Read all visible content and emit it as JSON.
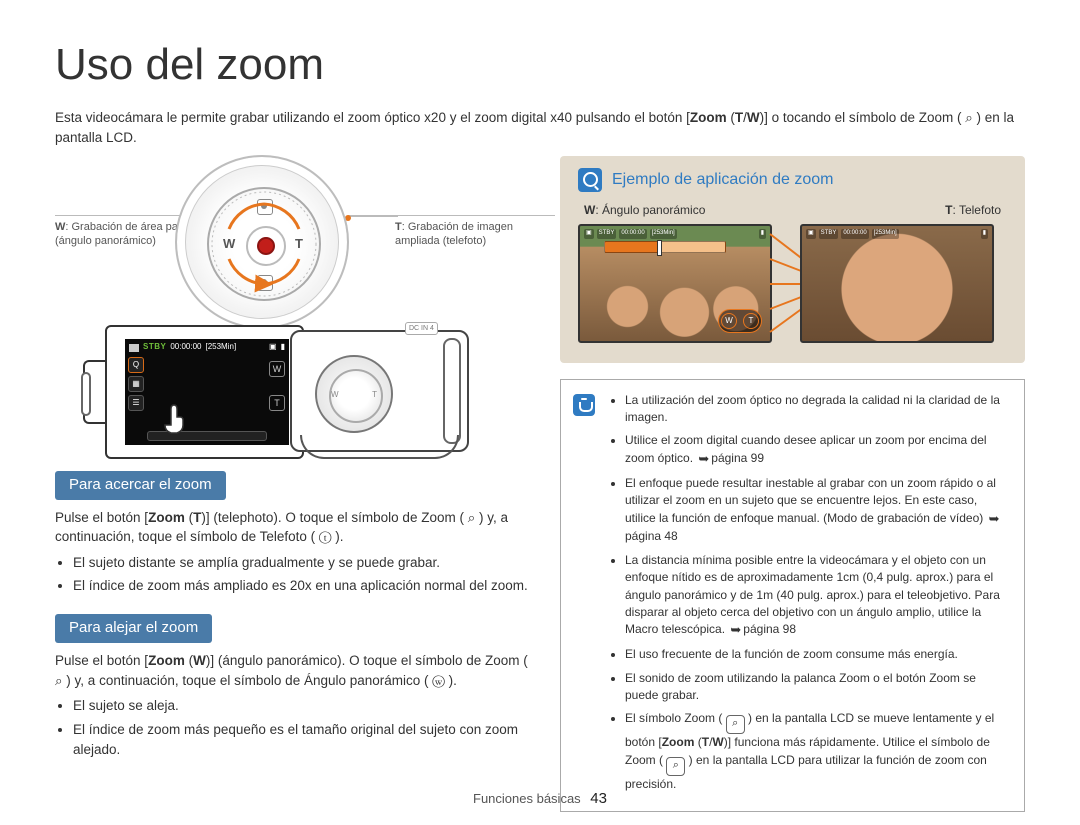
{
  "title": "Uso del zoom",
  "intro_html": "Esta videocámara le permite grabar utilizando el zoom óptico x20 y el zoom digital x40 pulsando el botón [<b>Zoom</b> (<b>T</b>/<b>W</b>)] o tocando el símbolo de Zoom ( ⌕ ) en la pantalla LCD.",
  "dial": {
    "w_letter": "W",
    "t_letter": "T",
    "callout_w_html": "<b>W</b>: Grabación de área panorámica (ángulo panorámico)",
    "callout_t_html": "<b>T</b>: Grabación de imagen ampliada (telefoto)"
  },
  "lcd": {
    "stby": "STBY",
    "time": "00:00:00",
    "remain": "[253Min]",
    "dcin": "DC IN 4"
  },
  "zoom_in": {
    "heading": "Para acercar el zoom",
    "para_html": "Pulse el botón [<b>Zoom</b> (<b>T</b>)] (telephoto). O toque el símbolo de Zoom ( ⌕ ) y, a continuación, toque el símbolo de Telefoto ( ⓣ ).",
    "b1": "El sujeto distante se amplía gradualmente y se puede grabar.",
    "b2": "El índice de zoom más ampliado es 20x en una aplicación normal del zoom."
  },
  "zoom_out": {
    "heading": "Para alejar el zoom",
    "para_html": "Pulse el botón [<b>Zoom</b> (<b>W</b>)] (ángulo panorámico). O toque el símbolo de Zoom ( ⌕ ) y, a continuación, toque el símbolo de Ángulo panorámico ( ⓦ ).",
    "b1": "El sujeto se aleja.",
    "b2": "El índice de zoom más pequeño es el tamaño original del sujeto con zoom alejado."
  },
  "example": {
    "title": "Ejemplo de aplicación de zoom",
    "w_label_html": "<b>W</b>: Ángulo panorámico",
    "t_label_html": "<b>T</b>: Telefoto",
    "wt_w": "W",
    "wt_t": "T"
  },
  "notes": {
    "n1": "La utilización del zoom óptico no degrada la calidad ni la claridad de la imagen.",
    "n2_html": "Utilice el zoom digital cuando desee aplicar un zoom por encima del zoom óptico. <span class='arrow-ref'>➥</span>página 99",
    "n3_html": "El enfoque puede resultar inestable al grabar con un zoom rápido o al utilizar el zoom en un sujeto que se encuentre lejos. En este caso, utilice la función de enfoque manual. (Modo de grabación de vídeo) <span class='arrow-ref'>➥</span>página 48",
    "n4_html": "La distancia mínima posible entre la videocámara y el objeto con un enfoque nítido es de aproximadamente 1cm (0,4 pulg. aprox.) para el ángulo panorámico y de 1m (40 pulg. aprox.) para el teleobjetivo. Para disparar al objeto cerca del objetivo con un ángulo amplio, utilice la Macro telescópica. <span class='arrow-ref'>➥</span>página 98",
    "n5": "El uso frecuente de la función de zoom consume más energía.",
    "n6": "El sonido de zoom utilizando la palanca Zoom o el botón Zoom se puede grabar.",
    "n7_html": "El símbolo Zoom ( <span class='sym'>⌕</span> ) en la pantalla LCD se mueve lentamente y el botón [<b>Zoom</b> (<b>T</b>/<b>W</b>)] funciona más rápidamente. Utilice el símbolo de Zoom ( <span class='sym'>⌕</span> ) en la pantalla LCD para utilizar la función de zoom con precisión."
  },
  "footer": {
    "section": "Funciones básicas",
    "page": "43"
  }
}
